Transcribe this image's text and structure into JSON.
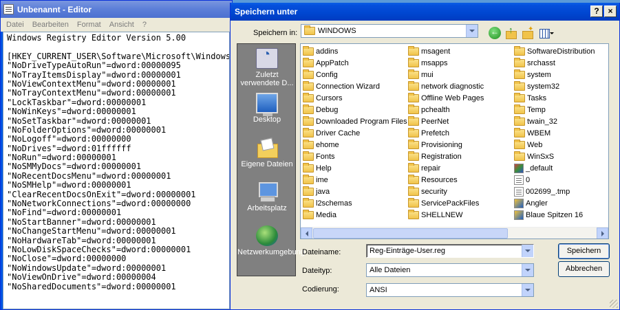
{
  "notepad": {
    "title": "Unbenannt - Editor",
    "menu": [
      "Datei",
      "Bearbeiten",
      "Format",
      "Ansicht",
      "?"
    ],
    "lines": [
      "Windows Registry Editor Version 5.00",
      "",
      "[HKEY_CURRENT_USER\\Software\\Microsoft\\Windows",
      "\"NoDriveTypeAutoRun\"=dword:00000095",
      "\"NoTrayItemsDisplay\"=dword:00000001",
      "\"NoViewContextMenu\"=dword:00000001",
      "\"NoTrayContextMenu\"=dword:00000001",
      "\"LockTaskbar\"=dword:00000001",
      "\"NoWinKeys\"=dword:00000001",
      "\"NoSetTaskbar\"=dword:00000001",
      "\"NoFolderOptions\"=dword:00000001",
      "\"NoLogoff\"=dword:00000000",
      "\"NoDrives\"=dword:01ffffff",
      "\"NoRun\"=dword:00000001",
      "\"NoSMMyDocs\"=dword:00000001",
      "\"NoRecentDocsMenu\"=dword:00000001",
      "\"NoSMHelp\"=dword:00000001",
      "\"ClearRecentDocsOnExit\"=dword:00000001",
      "\"NoNetworkConnections\"=dword:00000000",
      "\"NoFind\"=dword:00000001",
      "\"NoStartBanner\"=dword:00000001",
      "\"NoChangeStartMenu\"=dword:00000001",
      "\"NoHardwareTab\"=dword:00000001",
      "\"NoLowDiskSpaceChecks\"=dword:00000001",
      "\"NoClose\"=dword:00000000",
      "\"NoWindowsUpdate\"=dword:00000001",
      "\"NoViewOnDrive\"=dword:00000004",
      "\"NoSharedDocuments\"=dword:00000001"
    ]
  },
  "dialog": {
    "title": "Speichern unter",
    "help_btn": "?",
    "close_btn": "×",
    "lookin_label": "Speichern in:",
    "lookin_value": "WINDOWS",
    "toolbar_icons": [
      "back-icon",
      "up-folder-icon",
      "new-folder-icon",
      "views-menu-icon"
    ],
    "places": [
      {
        "label": "Zuletzt verwendete D...",
        "icon": "recent-documents-icon"
      },
      {
        "label": "Desktop",
        "icon": "desktop-icon"
      },
      {
        "label": "Eigene Dateien",
        "icon": "my-documents-icon"
      },
      {
        "label": "Arbeitsplatz",
        "icon": "my-computer-icon"
      },
      {
        "label": "Netzwerkumgebung",
        "icon": "network-places-icon"
      }
    ],
    "files": [
      [
        {
          "name": "addins",
          "type": "folder"
        },
        {
          "name": "AppPatch",
          "type": "folder"
        },
        {
          "name": "Config",
          "type": "folder"
        },
        {
          "name": "Connection Wizard",
          "type": "folder"
        },
        {
          "name": "Cursors",
          "type": "folder"
        },
        {
          "name": "Debug",
          "type": "folder"
        },
        {
          "name": "Downloaded Program Files",
          "type": "folder"
        },
        {
          "name": "Driver Cache",
          "type": "folder"
        },
        {
          "name": "ehome",
          "type": "folder"
        },
        {
          "name": "Fonts",
          "type": "folder"
        },
        {
          "name": "Help",
          "type": "folder"
        },
        {
          "name": "ime",
          "type": "folder"
        },
        {
          "name": "java",
          "type": "folder"
        },
        {
          "name": "l2schemas",
          "type": "folder"
        },
        {
          "name": "Media",
          "type": "folder"
        }
      ],
      [
        {
          "name": "msagent",
          "type": "folder"
        },
        {
          "name": "msapps",
          "type": "folder"
        },
        {
          "name": "mui",
          "type": "folder"
        },
        {
          "name": "network diagnostic",
          "type": "folder"
        },
        {
          "name": "Offline Web Pages",
          "type": "folder"
        },
        {
          "name": "pchealth",
          "type": "folder"
        },
        {
          "name": "PeerNet",
          "type": "folder"
        },
        {
          "name": "Prefetch",
          "type": "folder"
        },
        {
          "name": "Provisioning",
          "type": "folder"
        },
        {
          "name": "Registration",
          "type": "folder"
        },
        {
          "name": "repair",
          "type": "folder"
        },
        {
          "name": "Resources",
          "type": "folder"
        },
        {
          "name": "security",
          "type": "folder"
        },
        {
          "name": "ServicePackFiles",
          "type": "folder"
        },
        {
          "name": "SHELLNEW",
          "type": "folder"
        }
      ],
      [
        {
          "name": "SoftwareDistribution",
          "type": "folder"
        },
        {
          "name": "srchasst",
          "type": "folder"
        },
        {
          "name": "system",
          "type": "folder"
        },
        {
          "name": "system32",
          "type": "folder"
        },
        {
          "name": "Tasks",
          "type": "folder"
        },
        {
          "name": "Temp",
          "type": "folder"
        },
        {
          "name": "twain_32",
          "type": "folder"
        },
        {
          "name": "WBEM",
          "type": "folder"
        },
        {
          "name": "Web",
          "type": "folder"
        },
        {
          "name": "WinSxS",
          "type": "folder"
        },
        {
          "name": "_default",
          "type": "def"
        },
        {
          "name": "0",
          "type": "tmp"
        },
        {
          "name": "002699_.tmp",
          "type": "tmp"
        },
        {
          "name": "Angler",
          "type": "img"
        },
        {
          "name": "Blaue Spitzen 16",
          "type": "img"
        }
      ]
    ],
    "filename_label": "Dateiname:",
    "filename_value": "Reg-Einträge-User.reg",
    "filetype_label": "Dateityp:",
    "filetype_value": "Alle Dateien",
    "encoding_label": "Codierung:",
    "encoding_value": "ANSI",
    "save_button": "Speichern",
    "cancel_button": "Abbrechen"
  }
}
